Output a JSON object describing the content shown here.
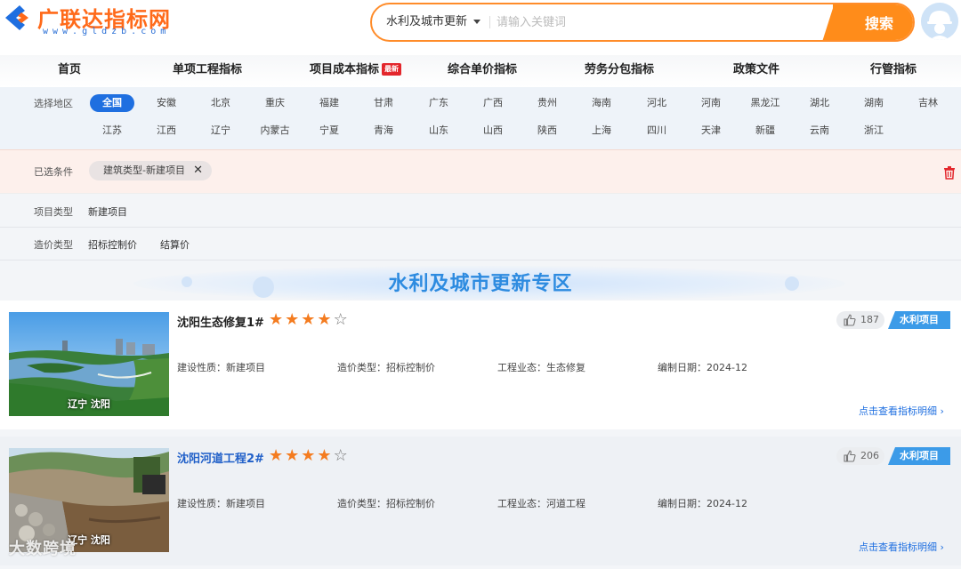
{
  "header": {
    "logo_text": "广联达指标网",
    "logo_sub": "www.gldzb.com",
    "search_scope": "水利及城市更新",
    "search_placeholder": "请输入关键词",
    "search_button": "搜索"
  },
  "nav": {
    "items": [
      {
        "label": "首页"
      },
      {
        "label": "单项工程指标"
      },
      {
        "label": "项目成本指标",
        "badge": "最新"
      },
      {
        "label": "综合单价指标"
      },
      {
        "label": "劳务分包指标"
      },
      {
        "label": "政策文件"
      },
      {
        "label": "行管指标"
      }
    ]
  },
  "region": {
    "label": "选择地区",
    "row1": [
      "全国",
      "安徽",
      "北京",
      "重庆",
      "福建",
      "甘肃",
      "广东",
      "广西",
      "贵州",
      "海南",
      "河北",
      "河南",
      "黑龙江",
      "湖北",
      "湖南",
      "吉林"
    ],
    "row2": [
      "江苏",
      "江西",
      "辽宁",
      "内蒙古",
      "宁夏",
      "青海",
      "山东",
      "山西",
      "陕西",
      "上海",
      "四川",
      "天津",
      "新疆",
      "云南",
      "浙江"
    ],
    "active": "全国"
  },
  "selected": {
    "label": "已选条件",
    "chip": "建筑类型-新建项目",
    "chip_close": "✕"
  },
  "filters": {
    "project_type": {
      "label": "项目类型",
      "options": [
        "新建项目"
      ]
    },
    "cost_type": {
      "label": "造价类型",
      "options": [
        "招标控制价",
        "结算价"
      ]
    }
  },
  "banner": {
    "title": "水利及城市更新专区"
  },
  "cards": [
    {
      "title": "沈阳生态修复1#",
      "rating": 4,
      "caption": "辽宁 沈阳",
      "likes": "187",
      "tag": "水利项目",
      "meta": {
        "nature": "建设性质：新建项目",
        "cost_type": "造价类型：招标控制价",
        "business": "工程业态：生态修复",
        "date": "编制日期：2024-12"
      },
      "link": "点击查看指标明细"
    },
    {
      "title": "沈阳河道工程2#",
      "rating": 4,
      "caption": "辽宁 沈阳",
      "likes": "206",
      "tag": "水利项目",
      "meta": {
        "nature": "建设性质：新建项目",
        "cost_type": "造价类型：招标控制价",
        "business": "工程业态：河道工程",
        "date": "编制日期：2024-12"
      },
      "link": "点击查看指标明细"
    }
  ],
  "watermark": "大数跨境",
  "colors": {
    "accent": "#ff8c1a",
    "primary": "#1f6fe0",
    "tag": "#3c9be8",
    "star": "#f47c20"
  }
}
